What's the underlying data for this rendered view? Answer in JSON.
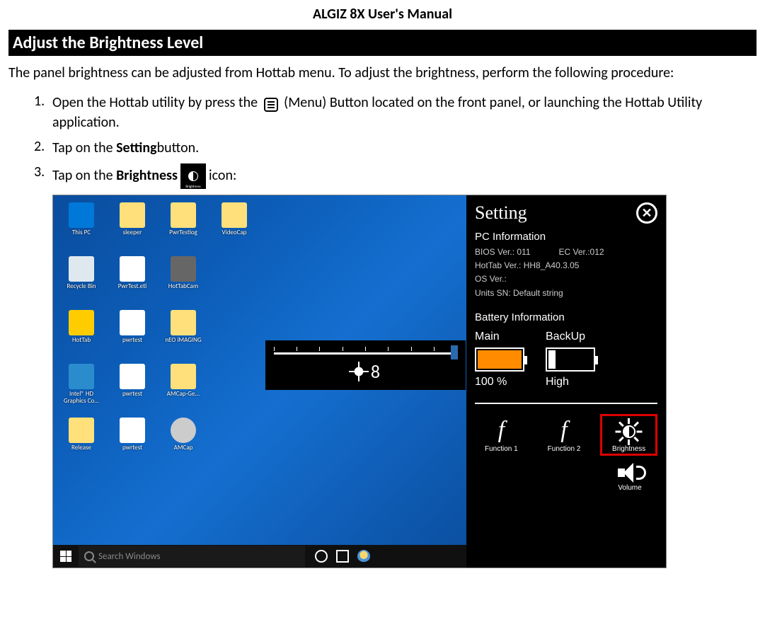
{
  "doc_title": "ALGIZ 8X User's Manual",
  "section_heading": "Adjust the Brightness Level",
  "intro_text": "The panel brightness can be adjusted from Hottab menu. To adjust the brightness, perform the following procedure:",
  "steps": {
    "s1_num": "1.",
    "s1_a": "Open the Hottab utility by press the",
    "s1_b": "(Menu) Button located on the front panel, or launching the Hottab Utility application.",
    "s2_num": "2.",
    "s2_a": "Tap on the ",
    "s2_bold": "Setting",
    "s2_b": "button.",
    "s3_num": "3.",
    "s3_a": "Tap on the ",
    "s3_bold": "Brightness",
    "s3_b": "icon:"
  },
  "desktop_icons": [
    {
      "label": "This PC",
      "cls": "pc"
    },
    {
      "label": "sleeper",
      "cls": "folder"
    },
    {
      "label": "PwrTestlog",
      "cls": "folder"
    },
    {
      "label": "VideoCap",
      "cls": "folder"
    },
    {
      "label": "Recycle Bin",
      "cls": "bin"
    },
    {
      "label": "PwrTest.etl",
      "cls": "file"
    },
    {
      "label": "HotTabCam",
      "cls": "cam"
    },
    {
      "label": "",
      "cls": ""
    },
    {
      "label": "HotTab",
      "cls": "hot"
    },
    {
      "label": "pwrtest",
      "cls": "file"
    },
    {
      "label": "nEO iMAGING",
      "cls": "folder"
    },
    {
      "label": "",
      "cls": ""
    },
    {
      "label": "Intel® HD Graphics Co...",
      "cls": "intel"
    },
    {
      "label": "pwrtest",
      "cls": "file"
    },
    {
      "label": "AMCap-Ge...",
      "cls": "folder"
    },
    {
      "label": "",
      "cls": ""
    },
    {
      "label": "Release",
      "cls": "folder"
    },
    {
      "label": "pwrtest",
      "cls": "file"
    },
    {
      "label": "AMCap",
      "cls": "gear"
    }
  ],
  "osd_value": "8",
  "taskbar": {
    "search_placeholder": "Search Windows"
  },
  "hottab": {
    "title": "Setting",
    "pc_info_label": "PC Information",
    "bios": "BIOS Ver.: 011",
    "ec": "EC Ver.:012",
    "hottab_ver": "HotTab Ver.: HH8_A40.3.05",
    "os_ver": "OS Ver.:",
    "sn": "Units SN: Default string",
    "battery_label": "Battery Information",
    "main_label": "Main",
    "main_pct": "100 %",
    "backup_label": "BackUp",
    "backup_level": "High",
    "fn1": "Function 1",
    "fn2": "Function 2",
    "brightness_label": "Brightness",
    "volume_label": "Volume"
  }
}
